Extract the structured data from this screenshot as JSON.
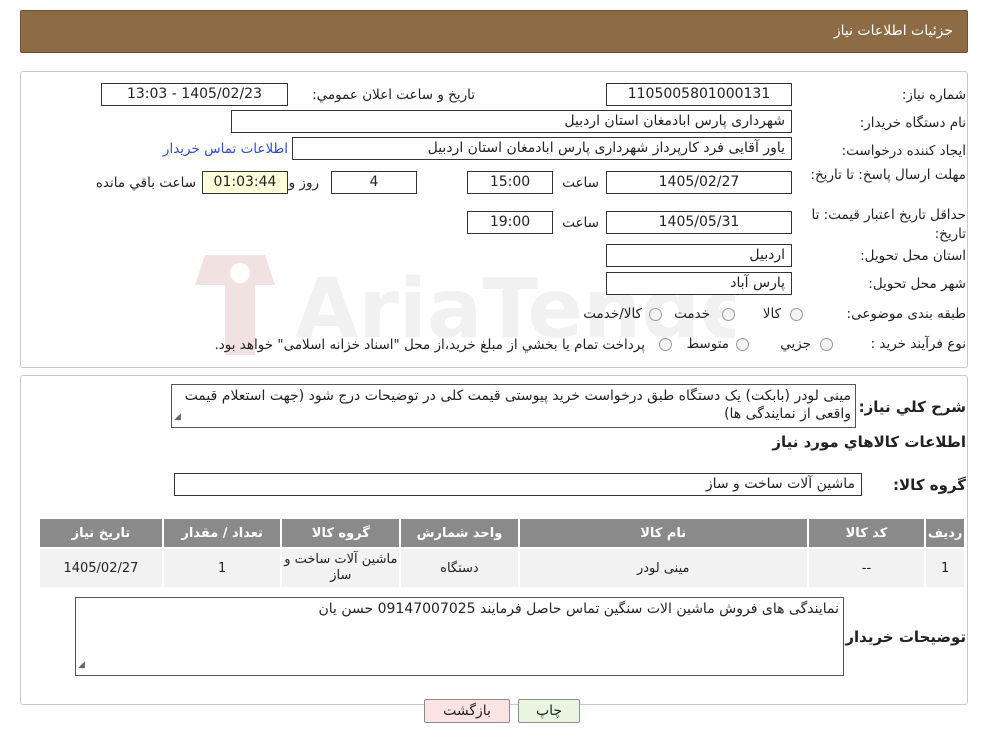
{
  "header": {
    "title": "جزئیات اطلاعات نیاز"
  },
  "fields": {
    "need_number_label": "شماره نیاز:",
    "need_number": "1105005801000131",
    "announce_label": "تاریخ و ساعت اعلان عمومي:",
    "announce_value": "1405/02/23 - 13:03",
    "buyer_org_label": "نام دستگاه خريدار:",
    "buyer_org": "شهرداری پارس ابادمغان استان اردبیل",
    "requester_label": "ايجاد کننده درخواست:",
    "requester": "یاور آقایی فرد کارپرداز شهرداری پارس ابادمغان استان اردبیل",
    "contact_link": "اطلاعات تماس خريدار",
    "deadline_label": "مهلت ارسال پاسخ: تا تاریخ:",
    "deadline_date": "1405/02/27",
    "time_label": "ساعت",
    "deadline_time": "15:00",
    "days_value": "4",
    "days_label": "روز و",
    "remaining_time": "01:03:44",
    "remaining_label": "ساعت باقي مانده",
    "validity_label": "حداقل تاريخ اعتبار قيمت: تا تاريخ:",
    "validity_date": "1405/05/31",
    "validity_time": "19:00",
    "province_label": "استان محل تحويل:",
    "province": "اردبیل",
    "city_label": "شهر محل تحويل:",
    "city": "پارس آباد",
    "category_label": "طبقه بندی موضوعی:",
    "category_options": [
      "کالا",
      "خدمت",
      "کالا/خدمت"
    ],
    "process_label": "نوع فرآيند خريد :",
    "process_options": [
      "جزيي",
      "متوسط"
    ],
    "process_note": "پرداخت تمام يا بخشي از مبلغ خريد،از محل \"اسناد خزانه اسلامی\" خواهد بود."
  },
  "description": {
    "label": "شرح کلي نياز:",
    "text": "مینی لودر (بابکت) یک دستگاه طبق درخواست خرید پیوستی قیمت کلی در توضیحات درج شود (جهت استعلام قیمت واقعی از نمایندگی ها)"
  },
  "goods": {
    "section_title": "اطلاعات کالاهاي مورد نياز",
    "group_label": "گروه کالا:",
    "group_value": "ماشین آلات ساخت و ساز",
    "columns": [
      "رديف",
      "کد کالا",
      "نام کالا",
      "واحد شمارش",
      "گروه کالا",
      "تعداد / مقدار",
      "تاريخ نياز"
    ],
    "rows": [
      {
        "row": "1",
        "code": "--",
        "name": "مینی لودر",
        "unit": "دستگاه",
        "group": "ماشین آلات ساخت و ساز",
        "qty": "1",
        "date": "1405/02/27"
      }
    ]
  },
  "buyer_notes": {
    "label": "توضيحات خريدار:",
    "text": "نمایندگی های فروش ماشین الات سنگین تماس حاصل فرمایند 09147007025 حسن یان"
  },
  "buttons": {
    "print": "چاپ",
    "back": "بازگشت"
  },
  "watermark": {
    "text": "AriaTender.neT"
  },
  "colors": {
    "header": "#8d6b45",
    "link": "#2a4fd1",
    "table_header": "#8a8a8a"
  }
}
